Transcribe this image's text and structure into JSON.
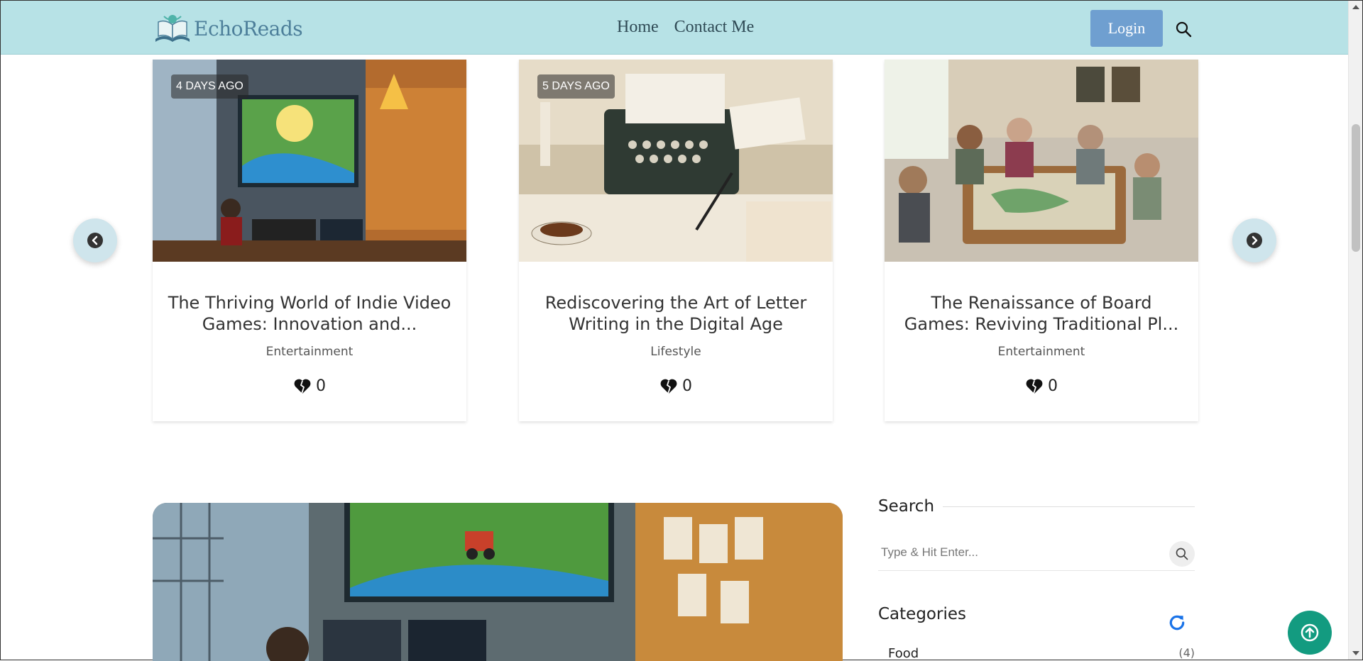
{
  "header": {
    "logo_text": "EchoReads",
    "nav": [
      {
        "label": "Home"
      },
      {
        "label": "Contact Me"
      }
    ],
    "login_label": "Login"
  },
  "carousel": {
    "cards": [
      {
        "date": "4 DAYS AGO",
        "title": "The Thriving World of Indie Video Games: Innovation and...",
        "category": "Entertainment",
        "likes": "0"
      },
      {
        "date": "5 DAYS AGO",
        "title": "Rediscovering the Art of Letter Writing in the Digital Age",
        "category": "Lifestyle",
        "likes": "0"
      },
      {
        "date": "",
        "title": "The Renaissance of Board Games: Reviving Traditional Pl...",
        "category": "Entertainment",
        "likes": "0"
      }
    ]
  },
  "sidebar": {
    "search_title": "Search",
    "search_placeholder": "Type & Hit Enter...",
    "categories_title": "Categories",
    "categories": [
      {
        "name": "Food",
        "count": "(4)"
      }
    ]
  },
  "colors": {
    "header_bg": "#b7e2e6",
    "login_bg": "#6f9fd0",
    "back_to_top": "#139b80",
    "refresh_icon": "#1a73e8"
  }
}
